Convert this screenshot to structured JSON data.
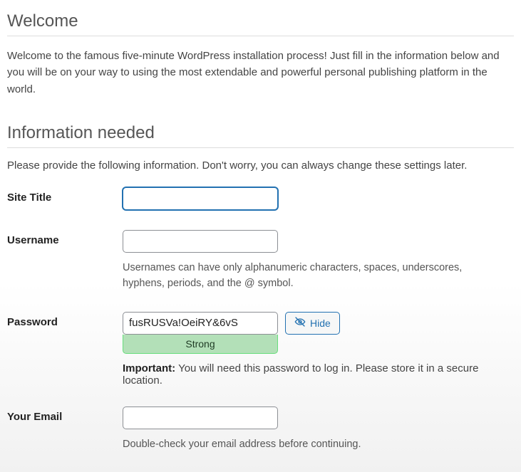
{
  "headings": {
    "welcome": "Welcome",
    "info_needed": "Information needed"
  },
  "intro_text": "Welcome to the famous five-minute WordPress installation process! Just fill in the information below and you will be on your way to using the most extendable and powerful personal publishing platform in the world.",
  "info_subtext": "Please provide the following information. Don't worry, you can always change these settings later.",
  "fields": {
    "site_title": {
      "label": "Site Title",
      "value": ""
    },
    "username": {
      "label": "Username",
      "value": "",
      "hint": "Usernames can have only alphanumeric characters, spaces, underscores, hyphens, periods, and the @ symbol."
    },
    "password": {
      "label": "Password",
      "value": "fusRUSVa!OeiRY&6vS",
      "strength": "Strong",
      "hide_label": "Hide",
      "important_label": "Important:",
      "important_text": " You will need this password to log in. Please store it in a secure location."
    },
    "email": {
      "label": "Your Email",
      "value": "",
      "hint": "Double-check your email address before continuing."
    }
  }
}
